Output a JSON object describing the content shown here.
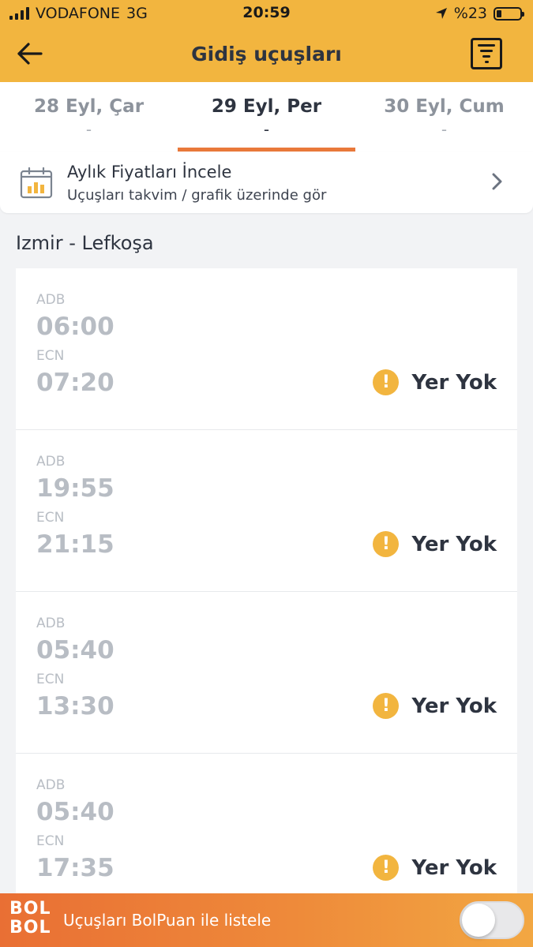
{
  "status_bar": {
    "carrier": "VODAFONE",
    "network": "3G",
    "time": "20:59",
    "battery": "%23"
  },
  "header": {
    "title": "Gidiş uçuşları"
  },
  "date_tabs": [
    {
      "label": "28 Eyl, Çar",
      "sub": "-",
      "active": false
    },
    {
      "label": "29 Eyl, Per",
      "sub": "-",
      "active": true
    },
    {
      "label": "30 Eyl, Cum",
      "sub": "-",
      "active": false
    }
  ],
  "monthly": {
    "title": "Aylık Fiyatları İncele",
    "subtitle": "Uçuşları takvim / grafik üzerinde gör"
  },
  "route": "Izmir - Lefkoşa",
  "flights": [
    {
      "dep_code": "ADB",
      "dep_time": "06:00",
      "arr_code": "ECN",
      "arr_time": "07:20",
      "status": "Yer Yok"
    },
    {
      "dep_code": "ADB",
      "dep_time": "19:55",
      "arr_code": "ECN",
      "arr_time": "21:15",
      "status": "Yer Yok"
    },
    {
      "dep_code": "ADB",
      "dep_time": "05:40",
      "arr_code": "ECN",
      "arr_time": "13:30",
      "status": "Yer Yok"
    },
    {
      "dep_code": "ADB",
      "dep_time": "05:40",
      "arr_code": "ECN",
      "arr_time": "17:35",
      "status": "Yer Yok"
    }
  ],
  "footer": {
    "logo_text": "BOL BOL",
    "label": "Uçuşları BolPuan ile listele",
    "toggle_on": false
  },
  "colors": {
    "accent": "#f2b53f",
    "tab_indicator": "#e9793a",
    "text_dark": "#2e3440",
    "text_muted": "#b8bdc4"
  },
  "icons": {
    "back": "arrow-left-icon",
    "filter": "filter-icon",
    "calendar": "calendar-chart-icon",
    "chevron": "chevron-right-icon",
    "warning": "exclamation-icon"
  }
}
